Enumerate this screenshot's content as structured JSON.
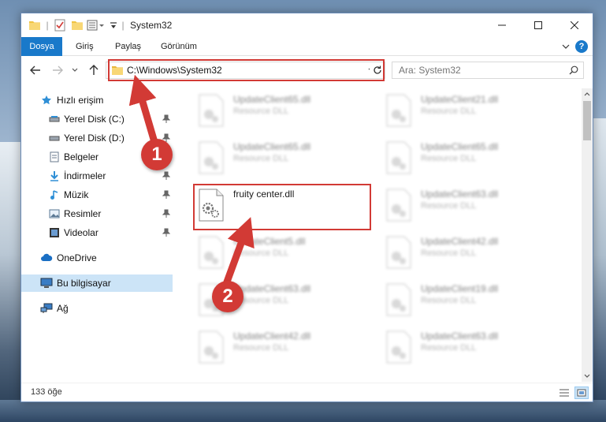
{
  "window": {
    "title": "System32",
    "minimize_label": "Minimize",
    "maximize_label": "Maximize",
    "close_label": "Close"
  },
  "ribbon": {
    "tabs": [
      "Dosya",
      "Giriş",
      "Paylaş",
      "Görünüm"
    ],
    "help": "?"
  },
  "address": {
    "path": "C:\\Windows\\System32"
  },
  "search": {
    "placeholder": "Ara: System32"
  },
  "sidebar": {
    "items": [
      {
        "label": "Hızlı erişim",
        "icon": "star-icon"
      },
      {
        "label": "Yerel Disk (C:)",
        "icon": "drive-icon"
      },
      {
        "label": "Yerel Disk (D:)",
        "icon": "drive-icon"
      },
      {
        "label": "Belgeler",
        "icon": "documents-icon"
      },
      {
        "label": "İndirmeler",
        "icon": "download-icon"
      },
      {
        "label": "Müzik",
        "icon": "music-icon"
      },
      {
        "label": "Resimler",
        "icon": "pictures-icon"
      },
      {
        "label": "Videolar",
        "icon": "videos-icon"
      },
      {
        "label": "OneDrive",
        "icon": "cloud-icon"
      },
      {
        "label": "Bu bilgisayar",
        "icon": "computer-icon"
      },
      {
        "label": "Ağ",
        "icon": "network-icon"
      }
    ]
  },
  "files": {
    "left": [
      {
        "name": "UpdateClient65.dll",
        "type": "Resource DLL"
      },
      {
        "name": "UpdateClient65.dll",
        "type": "Resource DLL"
      },
      {
        "name": "fruity center.dll",
        "type": ""
      },
      {
        "name": "UpdateClient5.dll",
        "type": "Resource DLL"
      },
      {
        "name": "UpdateClient63.dll",
        "type": "Resource DLL"
      },
      {
        "name": "UpdateClient42.dll",
        "type": "Resource DLL"
      }
    ],
    "right": [
      {
        "name": "UpdateClient21.dll",
        "type": "Resource DLL"
      },
      {
        "name": "UpdateClient65.dll",
        "type": "Resource DLL"
      },
      {
        "name": "UpdateClient63.dll",
        "type": "Resource DLL"
      },
      {
        "name": "UpdateClient42.dll",
        "type": "Resource DLL"
      },
      {
        "name": "UpdateClient19.dll",
        "type": "Resource DLL"
      },
      {
        "name": "UpdateClient63.dll",
        "type": "Resource DLL"
      }
    ]
  },
  "status": {
    "count": "133 öğe"
  },
  "annotations": {
    "step1": "1",
    "step2": "2",
    "color": "#d23a35"
  },
  "colors": {
    "accent": "#1979ca",
    "selection": "#cce4f7"
  }
}
